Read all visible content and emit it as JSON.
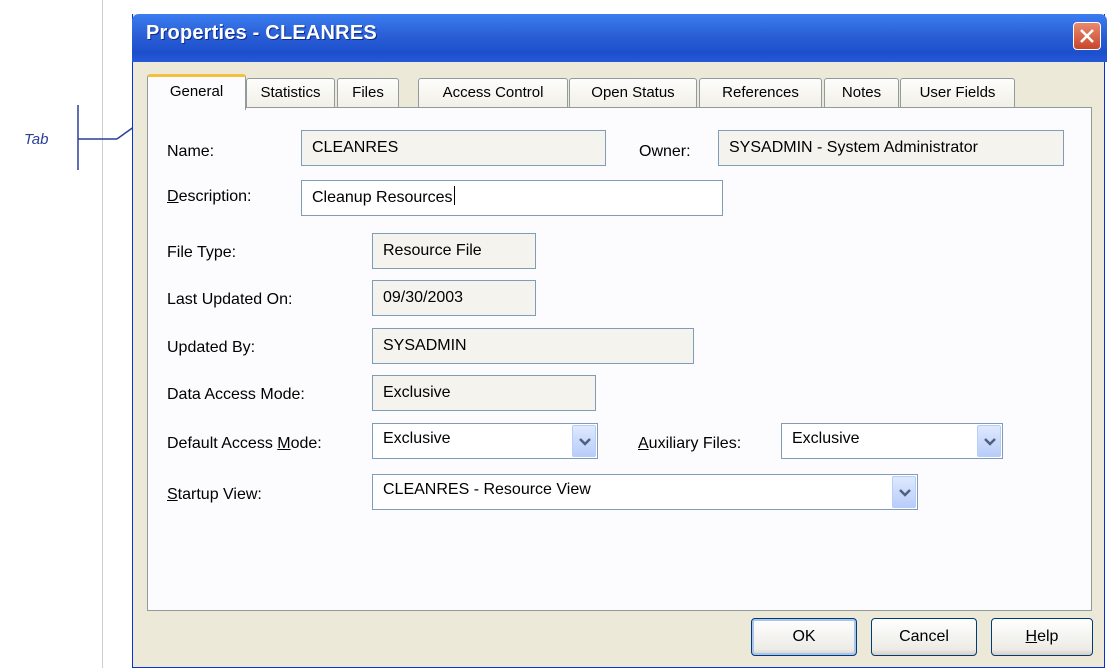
{
  "annotation": {
    "label": "Tab"
  },
  "window": {
    "title": "Properties - CLEANRES"
  },
  "tabs": [
    {
      "label": "General",
      "active": true
    },
    {
      "label": "Statistics"
    },
    {
      "label": "Files"
    },
    {
      "label": "Access Control"
    },
    {
      "label": "Open Status"
    },
    {
      "label": "References"
    },
    {
      "label": "Notes"
    },
    {
      "label": "User Fields"
    }
  ],
  "form": {
    "name": {
      "label": "Name:",
      "value": "CLEANRES"
    },
    "owner": {
      "label": "Owner:",
      "value": "SYSADMIN - System Administrator"
    },
    "description": {
      "label_mnemonic": "D",
      "label_rest": "escription:",
      "value": "Cleanup Resources"
    },
    "file_type": {
      "label": "File Type:",
      "value": "Resource File"
    },
    "last_updated": {
      "label": "Last Updated On:",
      "value": "09/30/2003"
    },
    "updated_by": {
      "label": "Updated By:",
      "value": "SYSADMIN"
    },
    "data_access_mode": {
      "label": "Data Access Mode:",
      "value": "Exclusive"
    },
    "default_access_mode": {
      "label_prefix": "Default Access ",
      "label_mnemonic": "M",
      "label_rest": "ode:",
      "value": "Exclusive"
    },
    "auxiliary_files": {
      "label_mnemonic": "A",
      "label_rest": "uxiliary Files:",
      "value": "Exclusive"
    },
    "startup_view": {
      "label_mnemonic": "S",
      "label_rest": "tartup View:",
      "value": "CLEANRES - Resource View"
    }
  },
  "buttons": {
    "ok": "OK",
    "cancel": "Cancel",
    "help_mnemonic": "H",
    "help_rest": "elp"
  },
  "colors": {
    "titlebar": "#2a5fd6",
    "dialog_bg": "#ece9d8",
    "active_tab_accent": "#f3c03f",
    "annotation": "#2a3e9a"
  }
}
